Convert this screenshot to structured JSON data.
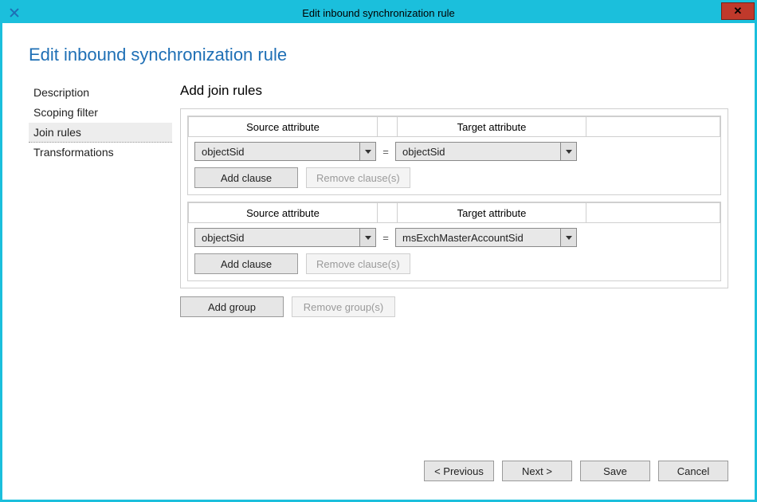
{
  "window": {
    "title": "Edit inbound synchronization rule"
  },
  "page": {
    "title": "Edit inbound synchronization rule"
  },
  "sidebar": {
    "items": [
      {
        "label": "Description",
        "selected": false
      },
      {
        "label": "Scoping filter",
        "selected": false
      },
      {
        "label": "Join rules",
        "selected": true
      },
      {
        "label": "Transformations",
        "selected": false
      }
    ]
  },
  "section": {
    "heading": "Add join rules",
    "col_source": "Source attribute",
    "col_target": "Target attribute",
    "equals": "="
  },
  "groups": [
    {
      "rows": [
        {
          "source": "objectSid",
          "target": "objectSid"
        }
      ],
      "add_clause_label": "Add clause",
      "remove_clause_label": "Remove clause(s)",
      "remove_clause_enabled": false
    },
    {
      "rows": [
        {
          "source": "objectSid",
          "target": "msExchMasterAccountSid"
        }
      ],
      "add_clause_label": "Add clause",
      "remove_clause_label": "Remove clause(s)",
      "remove_clause_enabled": false
    }
  ],
  "group_buttons": {
    "add_group_label": "Add group",
    "remove_group_label": "Remove group(s)",
    "remove_group_enabled": false
  },
  "footer": {
    "previous": "< Previous",
    "next": "Next >",
    "save": "Save",
    "cancel": "Cancel"
  }
}
